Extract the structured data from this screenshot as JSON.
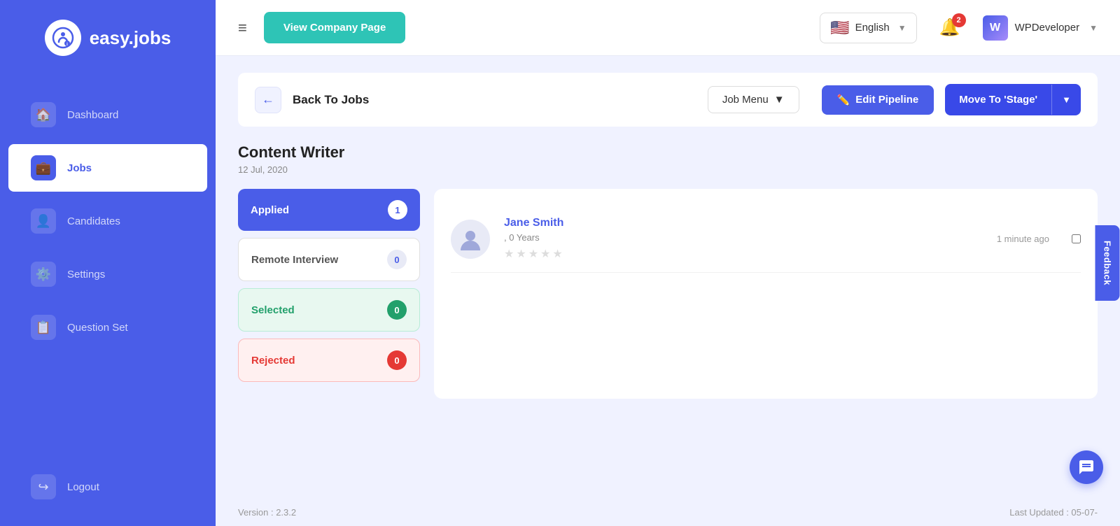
{
  "logo": {
    "icon": "i",
    "text": "easy.jobs"
  },
  "sidebar": {
    "items": [
      {
        "id": "dashboard",
        "label": "Dashboard",
        "icon": "🏠",
        "active": false
      },
      {
        "id": "jobs",
        "label": "Jobs",
        "icon": "💼",
        "active": true
      },
      {
        "id": "candidates",
        "label": "Candidates",
        "icon": "👤",
        "active": false
      },
      {
        "id": "settings",
        "label": "Settings",
        "icon": "⚙️",
        "active": false
      },
      {
        "id": "question-set",
        "label": "Question Set",
        "icon": "📋",
        "active": false
      }
    ],
    "logout": {
      "label": "Logout",
      "icon": "🚪"
    }
  },
  "topbar": {
    "menu_icon": "≡",
    "view_company_btn": "View Company Page",
    "language": {
      "flag": "🇺🇸",
      "label": "English"
    },
    "notifications": {
      "count": "2"
    },
    "user": {
      "name": "WPDeveloper",
      "logo_letter": "W"
    }
  },
  "breadcrumb": {
    "back_label": "Back To Jobs"
  },
  "job_menu": {
    "label": "Job Menu"
  },
  "toolbar": {
    "edit_pipeline_label": "Edit Pipeline",
    "move_to_stage_label": "Move To  'Stage'"
  },
  "job": {
    "title": "Content Writer",
    "date": "12 Jul, 2020"
  },
  "stages": [
    {
      "id": "applied",
      "label": "Applied",
      "count": "1",
      "type": "applied"
    },
    {
      "id": "remote-interview",
      "label": "Remote Interview",
      "count": "0",
      "type": "remote"
    },
    {
      "id": "selected",
      "label": "Selected",
      "count": "0",
      "type": "selected"
    },
    {
      "id": "rejected",
      "label": "Rejected",
      "count": "0",
      "type": "rejected"
    }
  ],
  "candidates": [
    {
      "name": "Jane Smith",
      "experience": "0 Years",
      "time_ago": "1 minute ago",
      "stars": [
        false,
        false,
        false,
        false,
        false
      ]
    }
  ],
  "footer": {
    "version": "Version : 2.3.2",
    "last_updated": "Last Updated : 05-07-"
  },
  "feedback": {
    "label": "Feedback"
  }
}
